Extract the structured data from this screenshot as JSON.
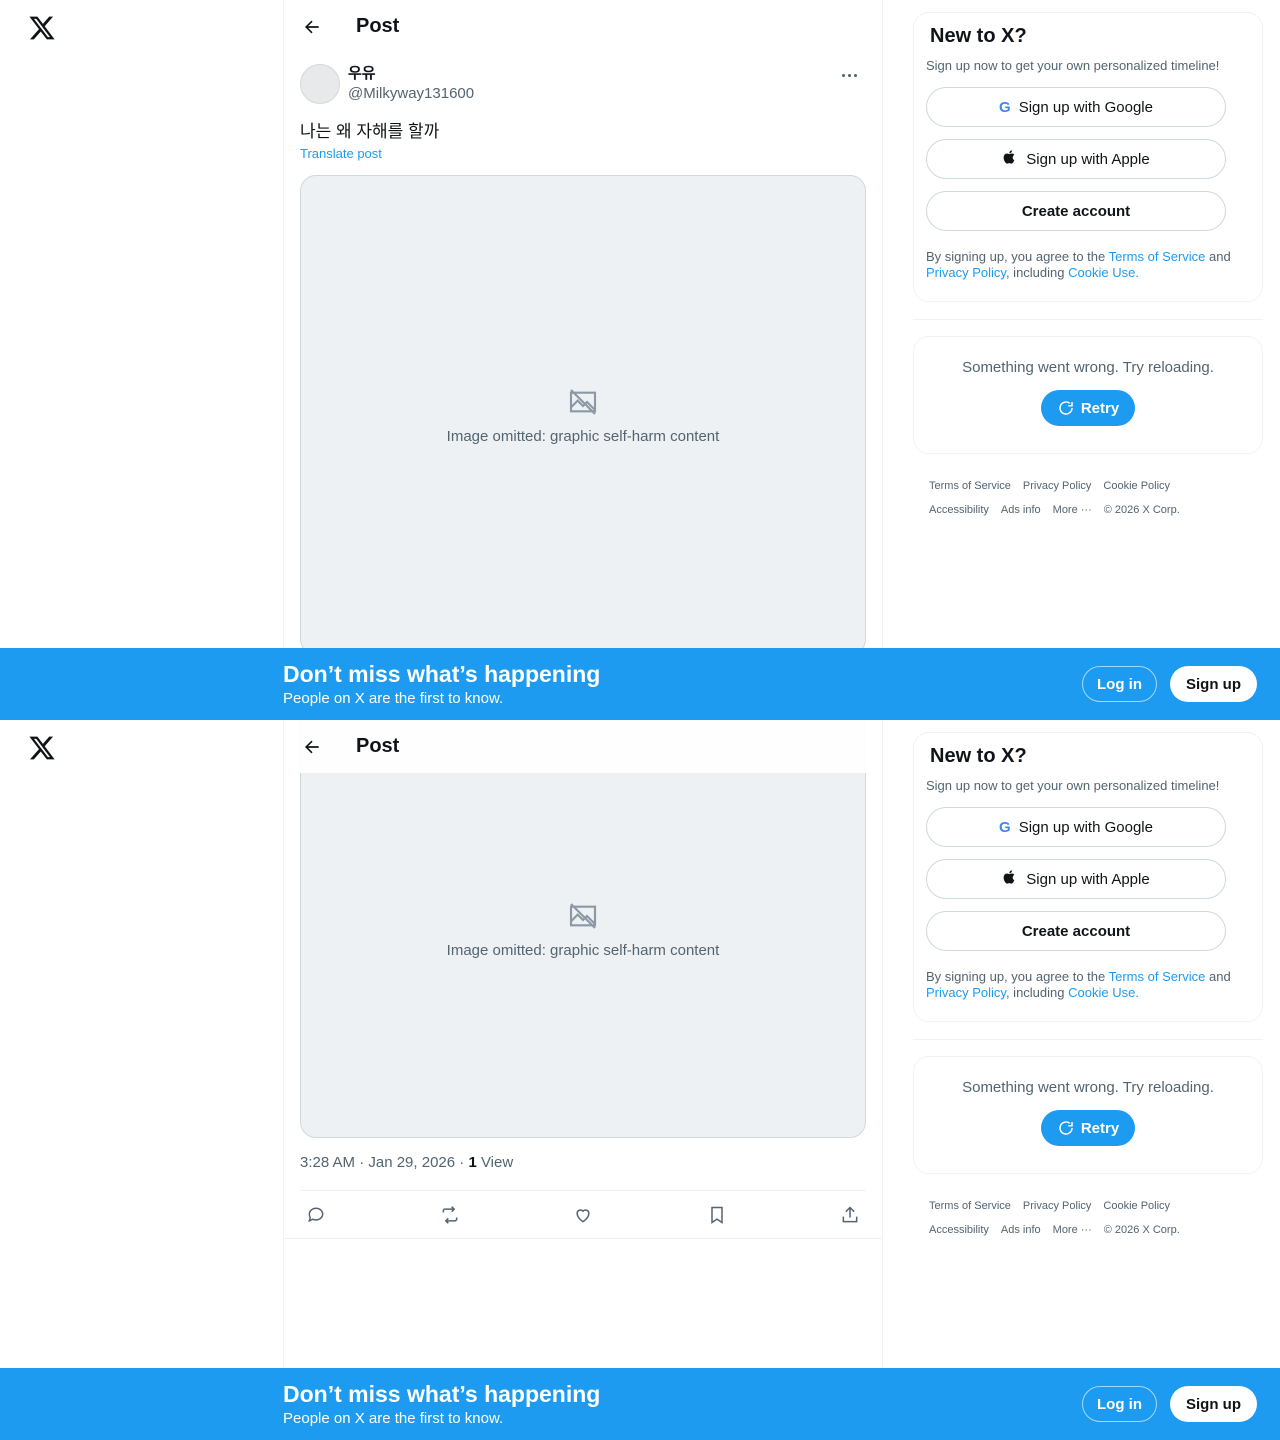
{
  "header": {
    "title": "Post"
  },
  "post": {
    "display_name": "우유",
    "handle": "@Milkyway131600",
    "text": "나는 왜 자해를 할까",
    "translate_label": "Translate post",
    "media_notice": "Image omitted: graphic self-harm content",
    "time": "3:28 AM · Jan 29, 2026 · ",
    "views_count": "1",
    "views_label": " View"
  },
  "sidebar": {
    "signup_title": "New to X?",
    "signup_sub": "Sign up now to get your own personalized timeline!",
    "google_label": "Sign up with Google",
    "apple_label": "Sign up with Apple",
    "create_label": "Create account",
    "legal_prefix": "By signing up, you agree to the ",
    "terms_label": "Terms of Service",
    "legal_and": " and ",
    "privacy_label": "Privacy Policy",
    "legal_including": ", including ",
    "cookie_label": "Cookie Use.",
    "error_text": "Something went wrong. Try reloading.",
    "retry_label": "Retry"
  },
  "footer": {
    "links": [
      "Terms of Service",
      "Privacy Policy",
      "Cookie Policy",
      "Accessibility",
      "Ads info",
      "More ···",
      "© 2026 X Corp."
    ]
  },
  "banner": {
    "title": "Don’t miss what’s happening",
    "subtitle": "People on X are the first to know.",
    "login_label": "Log in",
    "signup_label": "Sign up"
  },
  "colors": {
    "accent": "#1d9bf0",
    "text": "#0f1419",
    "muted": "#536471"
  }
}
